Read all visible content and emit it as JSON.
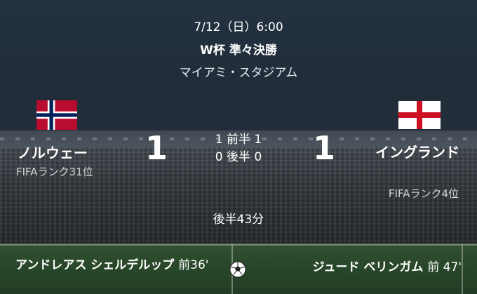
{
  "match": {
    "datetime": "7/12（日）6:00",
    "competition": "W杯 準々決勝",
    "venue": "マイアミ・スタジアム",
    "clock": "後半43分"
  },
  "home": {
    "name": "ノルウェー",
    "rank": "FIFAランク31位",
    "score": "1",
    "flag": "norway-flag-icon"
  },
  "away": {
    "name": "イングランド",
    "rank": "FIFAランク4位",
    "score": "1",
    "flag": "england-flag-icon"
  },
  "periods": {
    "first_half": "1 前半 1",
    "second_half": "0 後半 0"
  },
  "scorers": {
    "home": {
      "player": "アンドレアス シェルデルップ",
      "time": "前36'"
    },
    "away": {
      "player": "ジュード ベリンガム",
      "time": "前 47'"
    }
  },
  "colors": {
    "norway_red": "#BA0C2F",
    "norway_blue": "#00205B",
    "england_red": "#CE1124"
  }
}
